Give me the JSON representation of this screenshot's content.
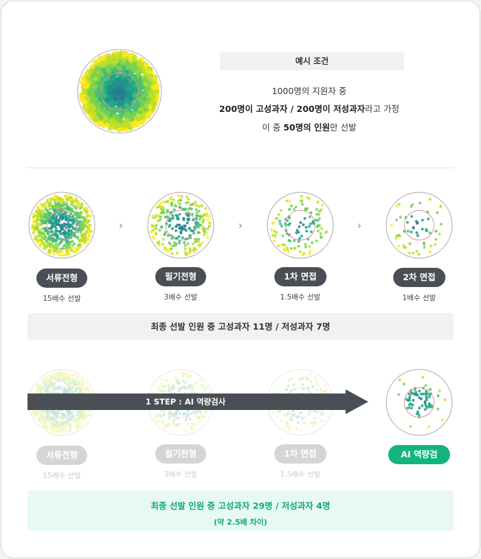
{
  "example": {
    "title": "예시 조건",
    "line1": "1000명의 지원자 중",
    "line2_bold1": "200명이 고성과자 / 200명이 저성과자",
    "line2_rest": "라고 가정",
    "line3_pre": "이 중 ",
    "line3_bold": "50명의 인원",
    "line3_post": "만 선발"
  },
  "flow1": {
    "steps": [
      {
        "label": "서류전형",
        "caption": "15배수 선발"
      },
      {
        "label": "필기전형",
        "caption": "3배수 선발"
      },
      {
        "label": "1차 면접",
        "caption": "1.5배수 선발"
      },
      {
        "label": "2차 면접",
        "caption": "1배수 선발"
      }
    ],
    "result": "최종 선발 인원 중 고성과자 11명 / 저성과자 7명"
  },
  "flow2": {
    "arrow_label": "1 STEP : AI 역량검사",
    "steps": [
      {
        "label": "서류전형",
        "caption": "15배수 선발"
      },
      {
        "label": "필기전형",
        "caption": "3배수 선발"
      },
      {
        "label": "1차 면접",
        "caption": "1.5배수 선발"
      },
      {
        "label": "AI 역량검사"
      }
    ],
    "result": "최종 선발 인원 중 고성과자 29명 / 저성과자 4명",
    "result_sub": "(약 2.5배 차이)"
  },
  "colors": {
    "dark": "#4a4f56",
    "accent": "#14b47e",
    "ring": "#e88aa0"
  }
}
